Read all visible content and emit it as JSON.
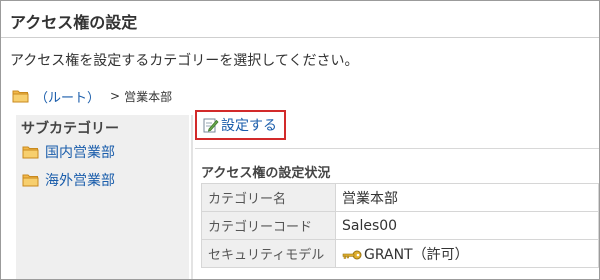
{
  "page": {
    "title": "アクセス権の設定",
    "instruction": "アクセス権を設定するカテゴリーを選択してください。"
  },
  "breadcrumb": {
    "root_label": "（ルート）",
    "separator": ">",
    "current": "営業本部"
  },
  "sidebar": {
    "heading": "サブカテゴリー",
    "items": [
      {
        "label": "国内営業部",
        "icon": "folder-icon"
      },
      {
        "label": "海外営業部",
        "icon": "folder-icon"
      }
    ]
  },
  "toolbar": {
    "set_label": "設定する",
    "set_icon": "edit-pen-icon"
  },
  "status": {
    "heading": "アクセス権の設定状況",
    "rows": [
      {
        "key": "カテゴリー名",
        "value": "営業本部"
      },
      {
        "key": "カテゴリーコード",
        "value": "Sales00"
      },
      {
        "key": "セキュリティモデル",
        "value": "GRANT（許可）",
        "icon": "key-icon"
      }
    ]
  },
  "colors": {
    "link": "#1a5dab",
    "highlight_border": "#d22a2a",
    "sidebar_bg": "#efefef",
    "folder": "#f2b84b"
  }
}
